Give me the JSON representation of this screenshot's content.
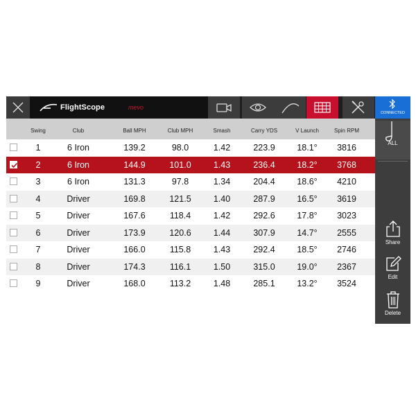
{
  "brand": {
    "name": "FlightScope",
    "sub": "mevo"
  },
  "sidebar": {
    "connection_label": "CONNECTED",
    "filter_label": "ALL",
    "share_label": "Share",
    "edit_label": "Edit",
    "delete_label": "Delete"
  },
  "colors": {
    "accent_red": "#c8102e",
    "selected_row": "#b5121b",
    "bluetooth": "#1a6fd6"
  },
  "table": {
    "columns": [
      "Swing",
      "Club",
      "Ball MPH",
      "Club MPH",
      "Smash",
      "Carry YDS",
      "V Launch",
      "Spin RPM"
    ],
    "rows": [
      [
        "1",
        "6 Iron",
        "139.2",
        "98.0",
        "1.42",
        "223.9",
        "18.1°",
        "3816"
      ],
      [
        "2",
        "6 Iron",
        "144.9",
        "101.0",
        "1.43",
        "236.4",
        "18.2°",
        "3768"
      ],
      [
        "3",
        "6 Iron",
        "131.3",
        "97.8",
        "1.34",
        "204.4",
        "18.6°",
        "4210"
      ],
      [
        "4",
        "Driver",
        "169.8",
        "121.5",
        "1.40",
        "287.9",
        "16.5°",
        "3619"
      ],
      [
        "5",
        "Driver",
        "167.6",
        "118.4",
        "1.42",
        "292.6",
        "17.8°",
        "3023"
      ],
      [
        "6",
        "Driver",
        "173.9",
        "120.6",
        "1.44",
        "307.9",
        "14.7°",
        "2555"
      ],
      [
        "7",
        "Driver",
        "166.0",
        "115.8",
        "1.43",
        "292.4",
        "18.5°",
        "2746"
      ],
      [
        "8",
        "Driver",
        "174.3",
        "116.1",
        "1.50",
        "315.0",
        "19.0°",
        "2367"
      ],
      [
        "9",
        "Driver",
        "168.0",
        "113.2",
        "1.48",
        "285.1",
        "13.2°",
        "3524"
      ]
    ],
    "selected_row": 1
  }
}
